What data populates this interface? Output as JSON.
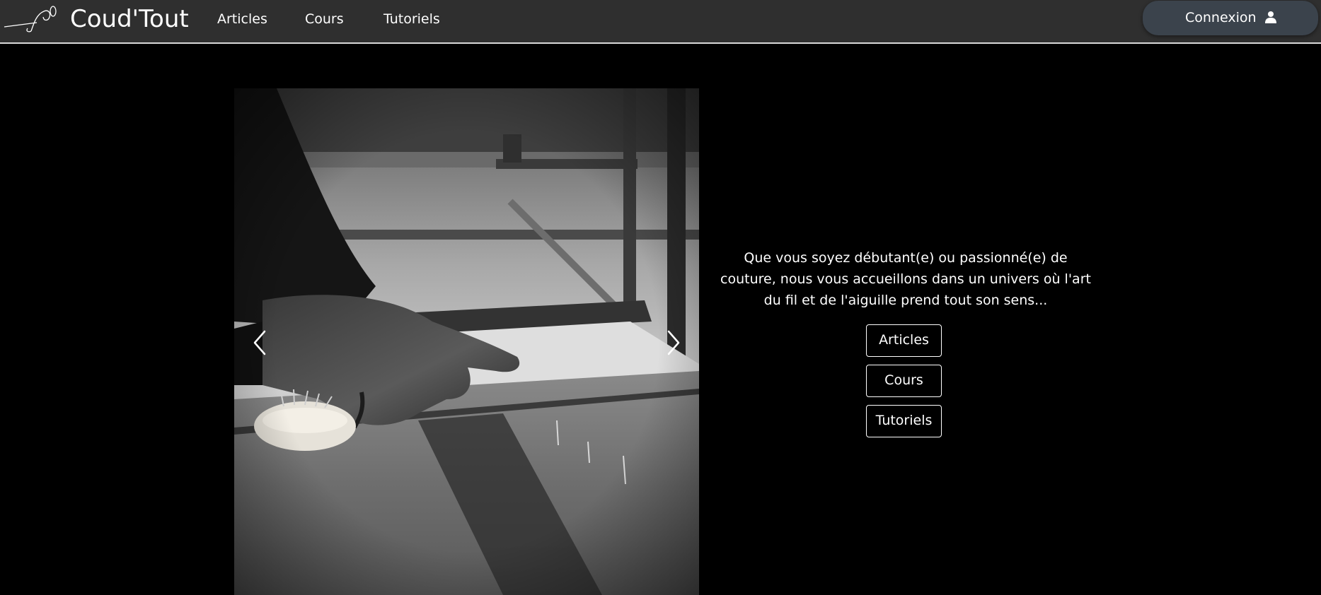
{
  "header": {
    "brand": "Coud'Tout",
    "nav": [
      {
        "label": "Articles"
      },
      {
        "label": "Cours"
      },
      {
        "label": "Tutoriels"
      }
    ],
    "login_label": "Connexion",
    "login_icon": "user-icon"
  },
  "hero": {
    "intro": "Que vous soyez débutant(e) ou passionné(e) de couture, nous vous accueillons dans un univers où l'art du fil et de l'aiguille prend tout son sens...",
    "buttons": [
      {
        "label": "Articles"
      },
      {
        "label": "Cours"
      },
      {
        "label": "Tutoriels"
      }
    ],
    "carousel_prev_icon": "chevron-left-icon",
    "carousel_next_icon": "chevron-right-icon"
  },
  "colors": {
    "page_background": "#000000",
    "navbar_background": "#2f2f2f",
    "login_button_background": "#3b434c",
    "text": "#ffffff"
  }
}
